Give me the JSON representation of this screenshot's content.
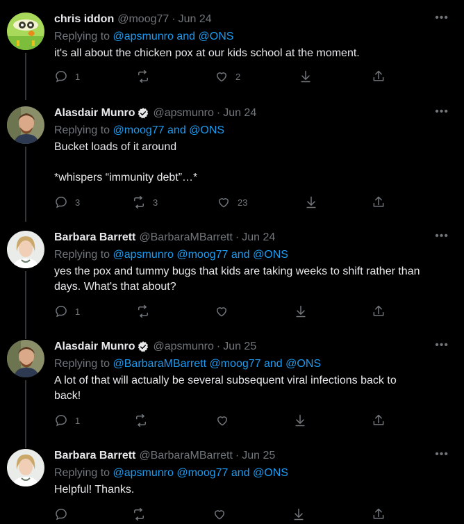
{
  "colors": {
    "background": "#000000",
    "text_primary": "#e7e9ea",
    "text_secondary": "#71767b",
    "link": "#1d9bf0",
    "verified_badge": "#e7e9ea",
    "thread_line": "#333639"
  },
  "tweets": [
    {
      "name": "chris iddon",
      "handle": "@moog77",
      "date": "Jun 24",
      "reply_prefix": "Replying to",
      "mentions_html_text": [
        "@apsmunro",
        "and",
        "@ONS"
      ],
      "text": "it's all about the chicken pox at our kids school at the moment.",
      "replies": "1",
      "retweets": "",
      "likes": "2",
      "verified": false,
      "avatar_icon": "cartoon-avatar"
    },
    {
      "name": "Alasdair Munro",
      "handle": "@apsmunro",
      "date": "Jun 24",
      "reply_prefix": "Replying to",
      "mentions_html_text": [
        "@moog77",
        "and",
        "@ONS"
      ],
      "text": "Bucket loads of it around\n\n*whispers “immunity debt”…*",
      "replies": "3",
      "retweets": "3",
      "likes": "23",
      "verified": true,
      "avatar_icon": "man-avatar"
    },
    {
      "name": "Barbara Barrett",
      "handle": "@BarbaraMBarrett",
      "date": "Jun 24",
      "reply_prefix": "Replying to",
      "mentions_html_text": [
        "@apsmunro",
        "@moog77",
        "and",
        "@ONS"
      ],
      "text": "yes the pox and tummy bugs that kids are taking weeks to shift rather than\ndays. What's that about?",
      "replies": "1",
      "retweets": "",
      "likes": "",
      "verified": false,
      "avatar_icon": "woman-avatar"
    },
    {
      "name": "Alasdair Munro",
      "handle": "@apsmunro",
      "date": "Jun 25",
      "reply_prefix": "Replying to",
      "mentions_html_text": [
        "@BarbaraMBarrett",
        "@moog77",
        "and",
        "@ONS"
      ],
      "text": "A lot of that will actually be several subsequent viral infections back to\nback!",
      "replies": "1",
      "retweets": "",
      "likes": "",
      "verified": true,
      "avatar_icon": "man-avatar"
    },
    {
      "name": "Barbara Barrett",
      "handle": "@BarbaraMBarrett",
      "date": "Jun 25",
      "reply_prefix": "Replying to",
      "mentions_html_text": [
        "@apsmunro",
        "@moog77",
        "and",
        "@ONS"
      ],
      "text": "Helpful! Thanks.",
      "replies": "",
      "retweets": "",
      "likes": "",
      "verified": false,
      "avatar_icon": "woman-avatar"
    }
  ]
}
